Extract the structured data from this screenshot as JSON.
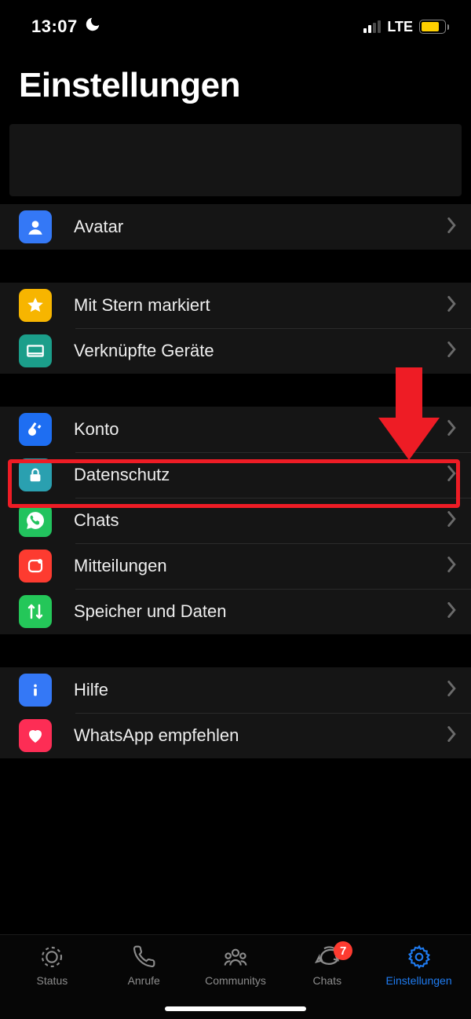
{
  "status": {
    "time": "13:07",
    "carrier": "LTE"
  },
  "title": "Einstellungen",
  "rows": {
    "avatar": {
      "label": "Avatar"
    },
    "starred": {
      "label": "Mit Stern markiert"
    },
    "devices": {
      "label": "Verknüpfte Geräte"
    },
    "account": {
      "label": "Konto"
    },
    "privacy": {
      "label": "Datenschutz"
    },
    "chats": {
      "label": "Chats"
    },
    "notif": {
      "label": "Mitteilungen"
    },
    "storage": {
      "label": "Speicher und Daten"
    },
    "help": {
      "label": "Hilfe"
    },
    "share": {
      "label": "WhatsApp empfehlen"
    }
  },
  "tabs": {
    "status": {
      "label": "Status"
    },
    "calls": {
      "label": "Anrufe"
    },
    "comm": {
      "label": "Communitys"
    },
    "chats": {
      "label": "Chats",
      "badge": "7"
    },
    "settings": {
      "label": "Einstellungen"
    }
  },
  "annotations": {
    "highlight_target": "privacy",
    "color": "#ee1c25"
  }
}
